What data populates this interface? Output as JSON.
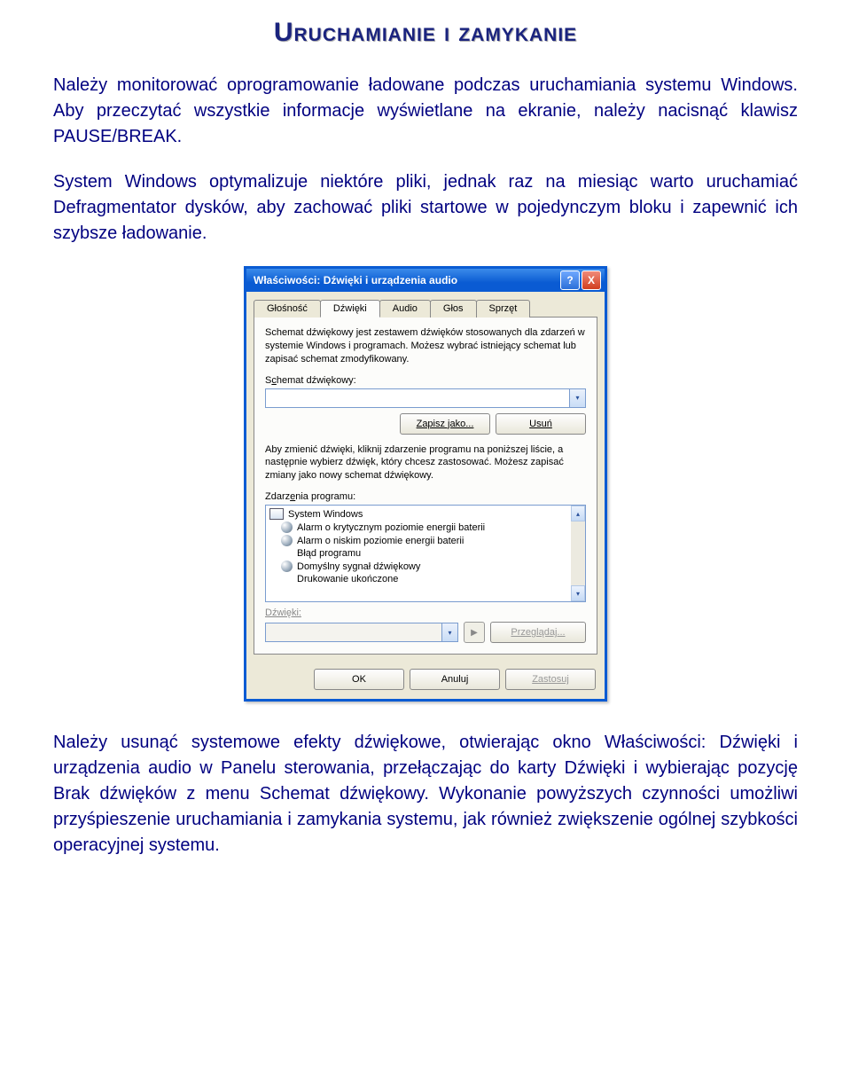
{
  "title": "Uruchamianie i zamykanie",
  "para1": "Należy monitorować oprogramowanie ładowane podczas uruchamiania systemu Windows. Aby przeczytać wszystkie informacje wyświetlane na ekranie, należy nacisnąć klawisz PAUSE/BREAK.",
  "para2": "System Windows optymalizuje niektóre pliki, jednak raz na miesiąc warto uruchamiać Defragmentator dysków, aby zachować pliki startowe w pojedynczym bloku i zapewnić ich szybsze ładowanie.",
  "para3": "Należy usunąć systemowe efekty dźwiękowe, otwierając okno Właściwości: Dźwięki i urządzenia audio w Panelu sterowania, przełączając do karty Dźwięki i wybierając pozycję Brak dźwięków z menu Schemat dźwiękowy. Wykonanie powyższych czynności umożliwi przyśpieszenie uruchamiania i zamykania systemu, jak również zwiększenie ogólnej szybkości operacyjnej systemu.",
  "dialog": {
    "title": "Właściwości: Dźwięki i urządzenia audio",
    "tabs": [
      "Głośność",
      "Dźwięki",
      "Audio",
      "Głos",
      "Sprzęt"
    ],
    "active_tab_index": 1,
    "scheme_desc": "Schemat dźwiękowy jest zestawem dźwięków stosowanych dla zdarzeń w systemie Windows i programach. Możesz wybrać istniejący schemat lub zapisać schemat zmodyfikowany.",
    "scheme_label_pre": "S",
    "scheme_label_u": "c",
    "scheme_label_post": "hemat dźwiękowy:",
    "save_as": "Zapisz jako...",
    "delete": "Usuń",
    "events_desc": "Aby zmienić dźwięki, kliknij zdarzenie programu na poniższej liście, a następnie wybierz dźwięk, który chcesz zastosować. Możesz zapisać zmiany jako nowy schemat dźwiękowy.",
    "events_label_pre": "Zdarz",
    "events_label_u": "e",
    "events_label_post": "nia programu:",
    "events": [
      {
        "type": "header",
        "text": "System Windows"
      },
      {
        "type": "sound",
        "text": "Alarm o krytycznym poziomie energii baterii"
      },
      {
        "type": "sound",
        "text": "Alarm o niskim poziomie energii baterii"
      },
      {
        "type": "plain",
        "text": "Błąd programu"
      },
      {
        "type": "sound",
        "text": "Domyślny sygnał dźwiękowy"
      },
      {
        "type": "plain",
        "text": "Drukowanie ukończone"
      }
    ],
    "sounds_label": "Dźwięki:",
    "browse": "Przeglądaj...",
    "ok": "OK",
    "cancel": "Anuluj",
    "apply": "Zastosuj"
  }
}
